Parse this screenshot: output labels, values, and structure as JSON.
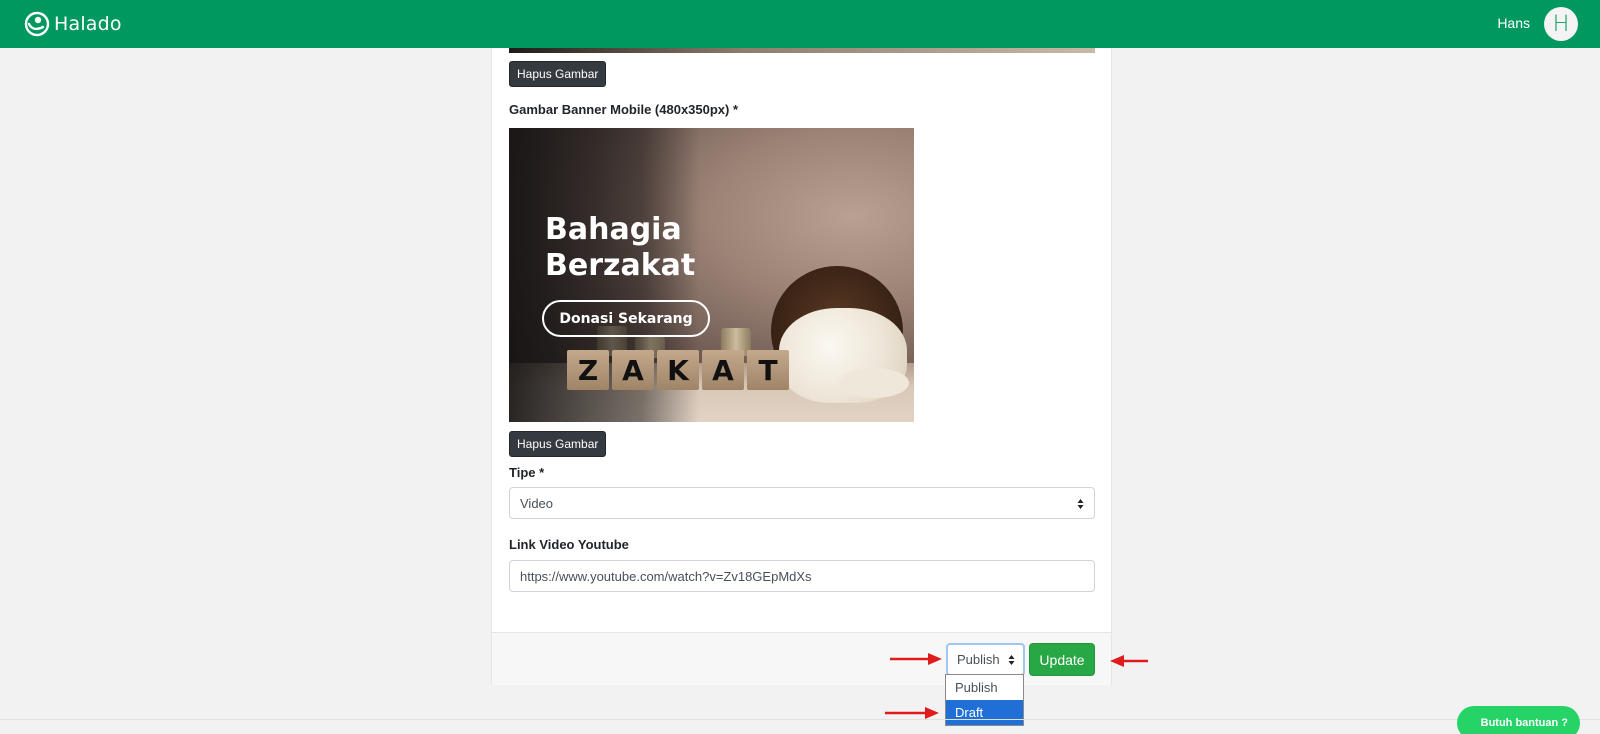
{
  "header": {
    "brand": "Halado",
    "user_name": "Hans",
    "avatar_initial": "H",
    "color": "#00985f"
  },
  "form": {
    "remove_image_label_1": "Hapus Gambar",
    "mobile_banner_label": "Gambar Banner Mobile (480x350px) *",
    "banner": {
      "title_line1": "Bahagia",
      "title_line2": "Berzakat",
      "cta": "Donasi Sekarang",
      "blocks": [
        "Z",
        "A",
        "K",
        "A",
        "T"
      ]
    },
    "remove_image_label_2": "Hapus Gambar",
    "type_label": "Tipe *",
    "type_value": "Video",
    "youtube_label": "Link Video Youtube",
    "youtube_value": "https://www.youtube.com/watch?v=Zv18GEpMdXs"
  },
  "footer": {
    "status_value": "Publish",
    "update_label": "Update",
    "status_options": [
      "Publish",
      "Draft"
    ],
    "highlighted_option": "Draft"
  },
  "help": {
    "label": "Butuh bantuan ?",
    "color": "#25d366"
  },
  "icons": {
    "brand": "halado-logo-icon",
    "caret": "sort-caret-icon",
    "arrow": "red-arrow-icon"
  }
}
